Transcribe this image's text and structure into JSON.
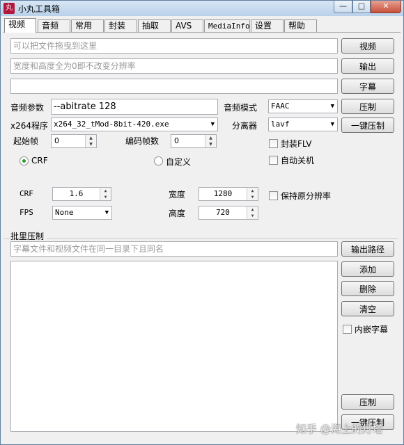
{
  "window": {
    "title": "小丸工具箱",
    "app_icon_text": "丸",
    "min_glyph": "—",
    "max_glyph": "□",
    "close_glyph": "✕"
  },
  "tabs": [
    {
      "label": "视频"
    },
    {
      "label": "音频"
    },
    {
      "label": "常用"
    },
    {
      "label": "封装"
    },
    {
      "label": "抽取"
    },
    {
      "label": "AVS"
    },
    {
      "label": "MediaInfo"
    },
    {
      "label": "设置"
    },
    {
      "label": "帮助"
    }
  ],
  "video": {
    "file_placeholder": "可以把文件拖曳到这里",
    "resolution_placeholder": "宽度和高度全为0即不改变分辨率",
    "subtitle_value": "",
    "video_button": "视频",
    "output_button": "输出",
    "subtitle_button": "字幕",
    "compress_button": "压制",
    "one_click_button": "一键压制",
    "audio_params_label": "音频参数",
    "audio_params_value": "--abitrate 128",
    "audio_mode_label": "音频模式",
    "audio_mode_value": "FAAC",
    "x264_label": "x264程序",
    "x264_value": "x264_32_tMod-8bit-420.exe",
    "demuxer_label": "分离器",
    "demuxer_value": "lavf",
    "start_frame_label": "起始帧",
    "start_frame_value": "0",
    "encode_frames_label": "编码帧数",
    "encode_frames_value": "0",
    "pack_flv_label": "封装FLV",
    "auto_shutdown_label": "自动关机",
    "crf_radio_label": "CRF",
    "custom_radio_label": "自定义",
    "crf_label": "CRF",
    "crf_value": "1.6",
    "fps_label": "FPS",
    "fps_value": "None",
    "width_label": "宽度",
    "width_value": "1280",
    "height_label": "高度",
    "height_value": "720",
    "keep_resolution_label": "保持原分辨率"
  },
  "batch": {
    "title": "批里压制",
    "placeholder": "字幕文件和视频文件在同一目录下且同名",
    "output_path_button": "输出路径",
    "add_button": "添加",
    "delete_button": "删除",
    "clear_button": "清空",
    "embed_subtitle_label": "内嵌字幕",
    "compress_button": "压制",
    "one_click_button": "一键压制"
  },
  "watermark": "知乎 @海上的灯塔",
  "spin_up": "▲",
  "spin_down": "▼",
  "dropdown_arrow": "▼"
}
